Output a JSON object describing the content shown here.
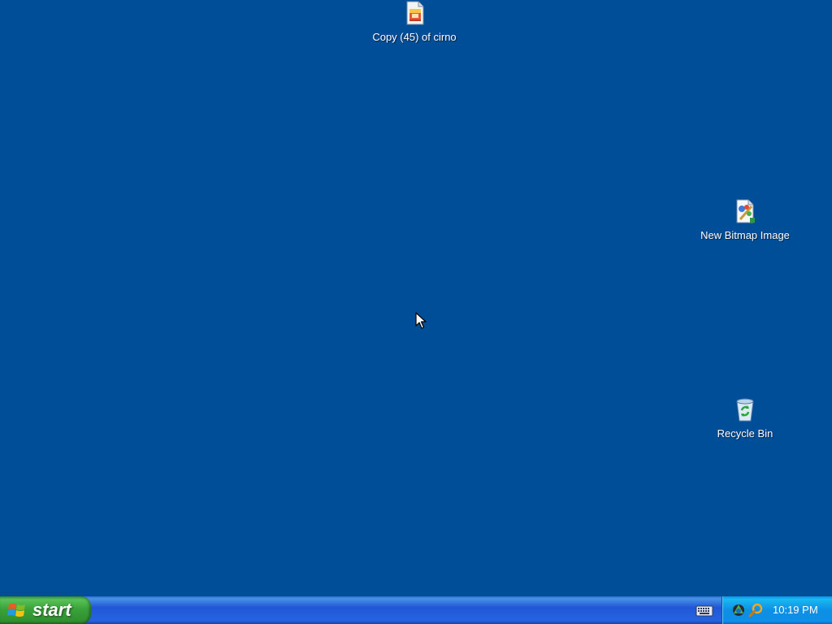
{
  "desktop": {
    "background_color": "#004e98",
    "icons": [
      {
        "label": "Copy (45) of cirno",
        "icon": "image-file-icon"
      },
      {
        "label": "New Bitmap Image",
        "icon": "bitmap-image-icon"
      },
      {
        "label": "Recycle Bin",
        "icon": "recycle-bin-icon"
      }
    ]
  },
  "taskbar": {
    "start_label": "start",
    "start_color": "#3aa33a",
    "taskbar_color": "#2157d7",
    "tray_color": "#0d8fe4",
    "language_icon": "keyboard-icon",
    "tray_icons": [
      "app-tray-icon",
      "magnifier-icon"
    ],
    "clock": "10:19 PM"
  }
}
